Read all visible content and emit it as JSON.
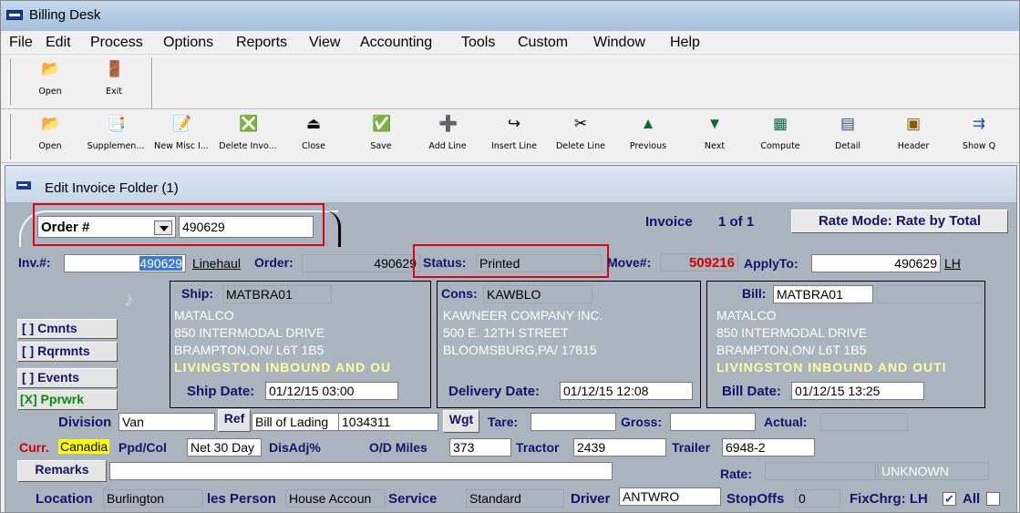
{
  "window": {
    "title": "Billing Desk"
  },
  "menu": [
    "File",
    "Edit",
    "Process",
    "Options",
    "Reports",
    "View",
    "Accounting",
    "Tools",
    "Custom",
    "Window",
    "Help"
  ],
  "toolbar1": [
    {
      "label": "Open",
      "icon": "open-folder-icon",
      "glyph": "📂"
    },
    {
      "label": "Exit",
      "icon": "exit-door-icon",
      "glyph": "🚪"
    }
  ],
  "toolbar2": [
    {
      "label": "Open",
      "icon": "open-folder-icon",
      "glyph": "📂"
    },
    {
      "label": "Supplemen...",
      "icon": "supplement-icon",
      "glyph": "📑"
    },
    {
      "label": "New Misc I...",
      "icon": "new-misc-icon",
      "glyph": "📝"
    },
    {
      "label": "Delete Invo...",
      "icon": "delete-invoice-icon",
      "glyph": "❎"
    },
    {
      "label": "Close",
      "icon": "close-icon",
      "glyph": "⏏"
    },
    {
      "label": "Save",
      "icon": "save-icon",
      "glyph": "✅"
    },
    {
      "label": "Add Line",
      "icon": "add-line-icon",
      "glyph": "➕"
    },
    {
      "label": "Insert Line",
      "icon": "insert-line-icon",
      "glyph": "↪"
    },
    {
      "label": "Delete Line",
      "icon": "delete-line-icon",
      "glyph": "✂"
    },
    {
      "label": "Previous",
      "icon": "previous-icon",
      "glyph": "▲"
    },
    {
      "label": "Next",
      "icon": "next-icon",
      "glyph": "▼"
    },
    {
      "label": "Compute",
      "icon": "compute-icon",
      "glyph": "▦"
    },
    {
      "label": "Detail",
      "icon": "detail-icon",
      "glyph": "▤"
    },
    {
      "label": "Header",
      "icon": "header-icon",
      "glyph": "▣"
    },
    {
      "label": "Show Q",
      "icon": "show-q-icon",
      "glyph": "⇉"
    }
  ],
  "doc": {
    "title": "Edit Invoice Folder (1)",
    "order_selector": {
      "label": "Order #",
      "value": "490629"
    },
    "invoice_counter": {
      "label": "Invoice",
      "value": "1 of 1"
    },
    "rate_mode": "Rate Mode: Rate by Total",
    "inv_no": {
      "label": "Inv.#:",
      "value": "490629"
    },
    "linehaul": "Linehaul",
    "order": {
      "label": "Order:",
      "value": "490629"
    },
    "status": {
      "label": "Status:",
      "value": "Printed"
    },
    "move": {
      "label": "Move#:",
      "value": "509216"
    },
    "apply_to": {
      "label": "ApplyTo:",
      "value": "490629",
      "suffix": "LH"
    },
    "side_buttons": [
      "[ ] Cmnts",
      "[ ] Rqrmnts",
      "[ ] Events",
      "[X] Pprwrk"
    ],
    "ship": {
      "label": "Ship:",
      "code": "MATBRA01",
      "lines": [
        "MATALCO",
        "850 INTERMODAL DRIVE",
        "BRAMPTON,ON/ L6T 1B5"
      ],
      "highlight": "LIVINGSTON INBOUND AND OU",
      "date_label": "Ship Date:",
      "date": "01/12/15 03:00"
    },
    "cons": {
      "label": "Cons:",
      "code": "KAWBLO",
      "lines": [
        "KAWNEER COMPANY INC.",
        "500 E. 12TH STREET",
        "BLOOMSBURG,PA/ 17815"
      ],
      "date_label": "Delivery Date:",
      "date": "01/12/15 12:08"
    },
    "bill": {
      "label": "Bill:",
      "code": "MATBRA01",
      "lines": [
        "MATALCO",
        "850 INTERMODAL DRIVE",
        "BRAMPTON,ON/ L6T 1B5"
      ],
      "highlight": "LIVINGSTON INBOUND AND OUTI",
      "date_label": "Bill Date:",
      "date": "01/12/15 13:25"
    },
    "division": {
      "label": "Division",
      "value": "Van"
    },
    "ref": {
      "button": "Ref",
      "type": "Bill of Lading",
      "value": "1034311"
    },
    "wgt_button": "Wgt",
    "tare_label": "Tare:",
    "gross_label": "Gross:",
    "actual_label": "Actual:",
    "currency": {
      "label": "Curr.",
      "value": "Canadia"
    },
    "ppd_col": {
      "label": "Ppd/Col",
      "value": "Net 30 Day"
    },
    "disadj_label": "DisAdj%",
    "od_miles": {
      "label": "O/D Miles",
      "value": "373"
    },
    "tractor": {
      "label": "Tractor",
      "value": "2439"
    },
    "trailer": {
      "label": "Trailer",
      "value": "6948-2"
    },
    "remarks_button": "Remarks",
    "rate": {
      "label": "Rate:",
      "value": "UNKNOWN"
    },
    "location": {
      "label": "Location",
      "value": "Burlington"
    },
    "sales_person": {
      "label": "les Person",
      "value": "House Accoun"
    },
    "service": {
      "label": "Service",
      "value": "Standard"
    },
    "driver": {
      "label": "Driver",
      "value": "ANTWRO"
    },
    "stopoffs": {
      "label": "StopOffs",
      "value": "0"
    },
    "fixchrg": {
      "label": "FixChrg: LH",
      "all_label": "All"
    }
  },
  "colors": {
    "highlight_red": "#e0001a",
    "label_navy": "#14146b",
    "move_red": "#d00000"
  }
}
